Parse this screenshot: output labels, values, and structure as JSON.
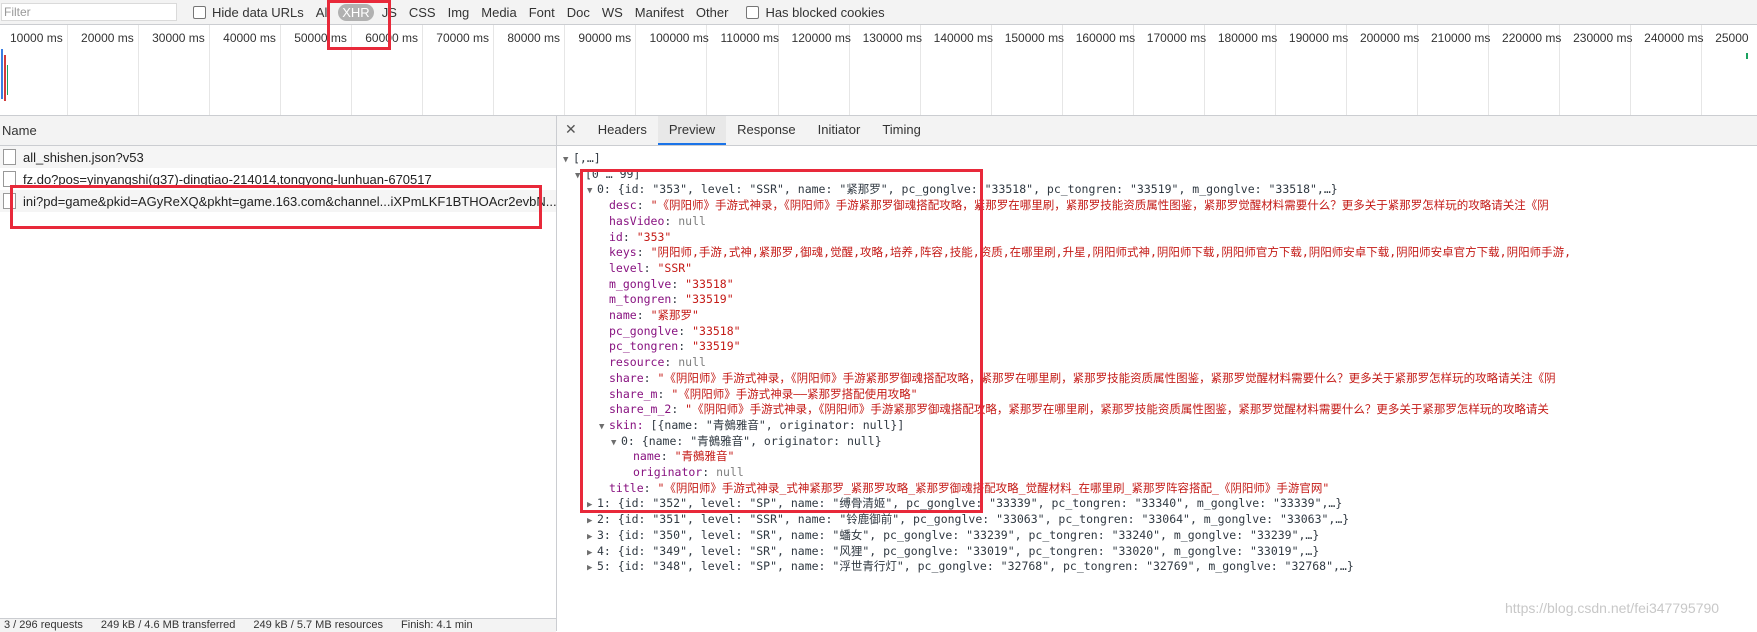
{
  "filterbar": {
    "filter_placeholder": "Filter",
    "hide_data_urls": "Hide data URLs",
    "types": [
      "All",
      "XHR",
      "JS",
      "CSS",
      "Img",
      "Media",
      "Font",
      "Doc",
      "WS",
      "Manifest",
      "Other"
    ],
    "selected_type": "XHR",
    "has_blocked_cookies": "Has blocked cookies"
  },
  "timeline": {
    "ticks": [
      "10000 ms",
      "20000 ms",
      "30000 ms",
      "40000 ms",
      "50000 ms",
      "60000 ms",
      "70000 ms",
      "80000 ms",
      "90000 ms",
      "100000 ms",
      "110000 ms",
      "120000 ms",
      "130000 ms",
      "140000 ms",
      "150000 ms",
      "160000 ms",
      "170000 ms",
      "180000 ms",
      "190000 ms",
      "200000 ms",
      "210000 ms",
      "220000 ms",
      "230000 ms",
      "240000 ms",
      "25000"
    ]
  },
  "requests": {
    "header": "Name",
    "items": [
      "all_shishen.json?v53",
      "fz.do?pos=yinyangshi(g37)-dingtiao-214014,tongyong-lunhuan-670517",
      "ini?pd=game&pkid=AGyReXQ&pkht=game.163.com&channel...iXPmLKF1BTHOAcr2evbN..."
    ]
  },
  "statusbar": [
    "3 / 296 requests",
    "249 kB / 4.6 MB transferred",
    "249 kB / 5.7 MB resources",
    "Finish: 4.1 min"
  ],
  "detail": {
    "tabs": [
      "Headers",
      "Preview",
      "Response",
      "Initiator",
      "Timing"
    ],
    "selected_tab": "Preview",
    "tree": {
      "root": "[,…]",
      "range": "[0 … 99]",
      "item0_summary": "0: {id: \"353\", level: \"SSR\", name: \"紧那罗\", pc_gonglve: \"33518\", pc_tongren: \"33519\", m_gonglve: \"33518\",…}",
      "fields": [
        {
          "key": "desc",
          "value": "\"《阴阳师》手游式神录，《阴阳师》手游紧那罗御魂搭配攻略，紧那罗在哪里刷，紧那罗技能资质属性图鉴，紧那罗觉醒材料需要什么？更多关于紧那罗怎样玩的攻略请关注《阴",
          "kind": "s"
        },
        {
          "key": "hasVideo",
          "value": "null",
          "kind": "n"
        },
        {
          "key": "id",
          "value": "\"353\"",
          "kind": "s"
        },
        {
          "key": "keys",
          "value": "\"阴阳师,手游,式神,紧那罗,御魂,觉醒,攻略,培养,阵容,技能,资质,在哪里刷,升星,阴阳师式神,阴阳师下载,阴阳师官方下载,阴阳师安卓下载,阴阳师安卓官方下载,阴阳师手游,",
          "kind": "s"
        },
        {
          "key": "level",
          "value": "\"SSR\"",
          "kind": "s"
        },
        {
          "key": "m_gonglve",
          "value": "\"33518\"",
          "kind": "s"
        },
        {
          "key": "m_tongren",
          "value": "\"33519\"",
          "kind": "s"
        },
        {
          "key": "name",
          "value": "\"紧那罗\"",
          "kind": "s"
        },
        {
          "key": "pc_gonglve",
          "value": "\"33518\"",
          "kind": "s"
        },
        {
          "key": "pc_tongren",
          "value": "\"33519\"",
          "kind": "s"
        },
        {
          "key": "resource",
          "value": "null",
          "kind": "n"
        },
        {
          "key": "share",
          "value": "\"《阴阳师》手游式神录，《阴阳师》手游紧那罗御魂搭配攻略，紧那罗在哪里刷，紧那罗技能资质属性图鉴，紧那罗觉醒材料需要什么？更多关于紧那罗怎样玩的攻略请关注《阴",
          "kind": "s"
        },
        {
          "key": "share_m",
          "value": "\"《阴阳师》手游式神录——紧那罗搭配使用攻略\"",
          "kind": "s"
        },
        {
          "key": "share_m_2",
          "value": "\"《阴阳师》手游式神录，《阴阳师》手游紧那罗御魂搭配攻略，紧那罗在哪里刷，紧那罗技能资质属性图鉴，紧那罗觉醒材料需要什么？更多关于紧那罗怎样玩的攻略请关",
          "kind": "s"
        }
      ],
      "skin_summary": "[{name: \"青鵺雅音\", originator: null}]",
      "skin0_summary": "0: {name: \"青鵺雅音\", originator: null}",
      "skin0_fields": [
        {
          "key": "name",
          "value": "\"青鵺雅音\"",
          "kind": "s"
        },
        {
          "key": "originator",
          "value": "null",
          "kind": "n"
        }
      ],
      "title": {
        "key": "title",
        "value": "\"《阴阳师》手游式神录_式神紧那罗_紧那罗攻略_紧那罗御魂搭配攻略_觉醒材料_在哪里刷_紧那罗阵容搭配_《阴阳师》手游官网\""
      },
      "collapsed": [
        "1: {id: \"352\", level: \"SP\", name: \"缚骨清姬\", pc_gonglve: \"33339\", pc_tongren: \"33340\", m_gonglve: \"33339\",…}",
        "2: {id: \"351\", level: \"SSR\", name: \"铃鹿御前\", pc_gonglve: \"33063\", pc_tongren: \"33064\", m_gonglve: \"33063\",…}",
        "3: {id: \"350\", level: \"SR\", name: \"蟠女\", pc_gonglve: \"33239\", pc_tongren: \"33240\", m_gonglve: \"33239\",…}",
        "4: {id: \"349\", level: \"SR\", name: \"风狸\", pc_gonglve: \"33019\", pc_tongren: \"33020\", m_gonglve: \"33019\",…}",
        "5: {id: \"348\", level: \"SP\", name: \"浮世青行灯\", pc_gonglve: \"32768\", pc_tongren: \"32769\", m_gonglve: \"32768\",…}"
      ]
    }
  },
  "watermark": "https://blog.csdn.net/fei347795790",
  "colors": {
    "highlight_box": "#e8293a",
    "tab_underline": "#1a73e8",
    "string_value": "#c41a16",
    "key": "#881280"
  }
}
